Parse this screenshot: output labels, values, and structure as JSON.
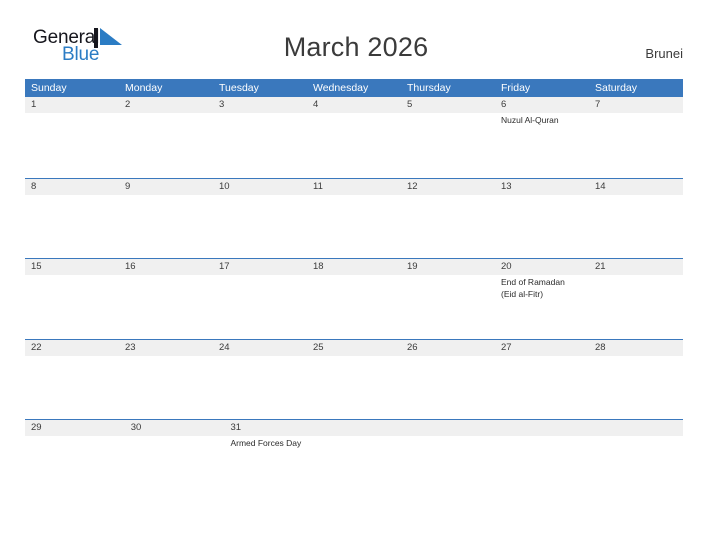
{
  "brand": {
    "word_general": "General",
    "word_blue": "Blue",
    "flag_icon": "blue-flag-triangle-icon",
    "general_color": "#16161d",
    "blue_color": "#2b7cc4"
  },
  "header": {
    "title": "March 2026",
    "country": "Brunei"
  },
  "theme": {
    "header_blue": "#3a78bd",
    "band_gray": "#f0f0f0",
    "text_dark": "#3b3b3b",
    "background": "#ffffff"
  },
  "calendar": {
    "weekdays": [
      "Sunday",
      "Monday",
      "Tuesday",
      "Wednesday",
      "Thursday",
      "Friday",
      "Saturday"
    ],
    "weeks": [
      {
        "days": [
          {
            "date": "1",
            "events": []
          },
          {
            "date": "2",
            "events": []
          },
          {
            "date": "3",
            "events": []
          },
          {
            "date": "4",
            "events": []
          },
          {
            "date": "5",
            "events": []
          },
          {
            "date": "6",
            "events": [
              "Nuzul Al-Quran"
            ]
          },
          {
            "date": "7",
            "events": []
          }
        ]
      },
      {
        "days": [
          {
            "date": "8",
            "events": []
          },
          {
            "date": "9",
            "events": []
          },
          {
            "date": "10",
            "events": []
          },
          {
            "date": "11",
            "events": []
          },
          {
            "date": "12",
            "events": []
          },
          {
            "date": "13",
            "events": []
          },
          {
            "date": "14",
            "events": []
          }
        ]
      },
      {
        "days": [
          {
            "date": "15",
            "events": []
          },
          {
            "date": "16",
            "events": []
          },
          {
            "date": "17",
            "events": []
          },
          {
            "date": "18",
            "events": []
          },
          {
            "date": "19",
            "events": []
          },
          {
            "date": "20",
            "events": [
              "End of Ramadan",
              "(Eid al-Fitr)"
            ]
          },
          {
            "date": "21",
            "events": []
          }
        ]
      },
      {
        "days": [
          {
            "date": "22",
            "events": []
          },
          {
            "date": "23",
            "events": []
          },
          {
            "date": "24",
            "events": []
          },
          {
            "date": "25",
            "events": []
          },
          {
            "date": "26",
            "events": []
          },
          {
            "date": "27",
            "events": []
          },
          {
            "date": "28",
            "events": []
          }
        ]
      },
      {
        "days": [
          {
            "date": "29",
            "events": []
          },
          {
            "date": "30",
            "events": []
          },
          {
            "date": "31",
            "events": [
              "Armed Forces Day"
            ]
          },
          {
            "date": "",
            "events": []
          },
          {
            "date": "",
            "events": []
          },
          {
            "date": "",
            "events": []
          },
          {
            "date": "",
            "events": []
          }
        ]
      }
    ]
  }
}
